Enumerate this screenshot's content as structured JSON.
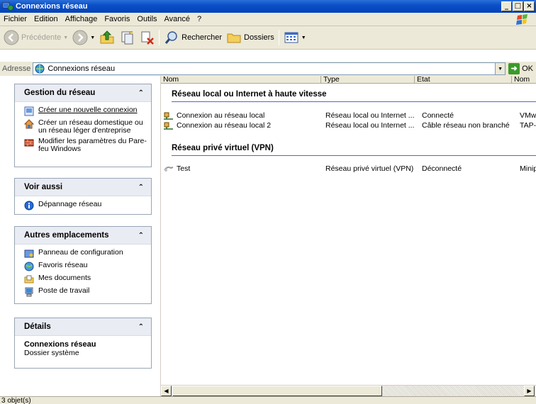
{
  "window": {
    "title": "Connexions réseau",
    "caption_buttons": [
      "_",
      "□",
      "×"
    ]
  },
  "menu": [
    "Fichier",
    "Edition",
    "Affichage",
    "Favoris",
    "Outils",
    "Avancé",
    "?"
  ],
  "toolbar": {
    "back_label": "Précédente",
    "search_label": "Rechercher",
    "folders_label": "Dossiers"
  },
  "address": {
    "label": "Adresse",
    "value": "Connexions réseau",
    "go_label": "OK"
  },
  "taskpane": {
    "network_tasks": {
      "title": "Gestion du réseau",
      "items": [
        "Créer une nouvelle connexion",
        "Créer un réseau domestique ou un réseau léger d'entreprise",
        "Modifier les paramètres du Pare-feu Windows"
      ]
    },
    "see_also": {
      "title": "Voir aussi",
      "items": [
        "Dépannage réseau"
      ]
    },
    "other_places": {
      "title": "Autres emplacements",
      "items": [
        "Panneau de configuration",
        "Favoris réseau",
        "Mes documents",
        "Poste de travail"
      ]
    },
    "details": {
      "title": "Détails",
      "name": "Connexions réseau",
      "subtitle": "Dossier système"
    }
  },
  "list": {
    "columns": [
      "Nom",
      "Type",
      "État",
      "Nom"
    ],
    "groups": [
      {
        "title": "Réseau local ou Internet à haute vitesse",
        "rows": [
          {
            "name": "Connexion au réseau local",
            "type": "Réseau local ou Internet ...",
            "state": "Connecté",
            "device": "VMw"
          },
          {
            "name": "Connexion au réseau local 2",
            "type": "Réseau local ou Internet ...",
            "state": "Câble réseau non branché",
            "device": "TAP-"
          }
        ]
      },
      {
        "title": "Réseau privé virtuel (VPN)",
        "rows": [
          {
            "name": "Test",
            "type": "Réseau privé virtuel (VPN)",
            "state": "Déconnecté",
            "device": "Minip"
          }
        ]
      }
    ]
  },
  "status": {
    "text": "3 objet(s)"
  }
}
